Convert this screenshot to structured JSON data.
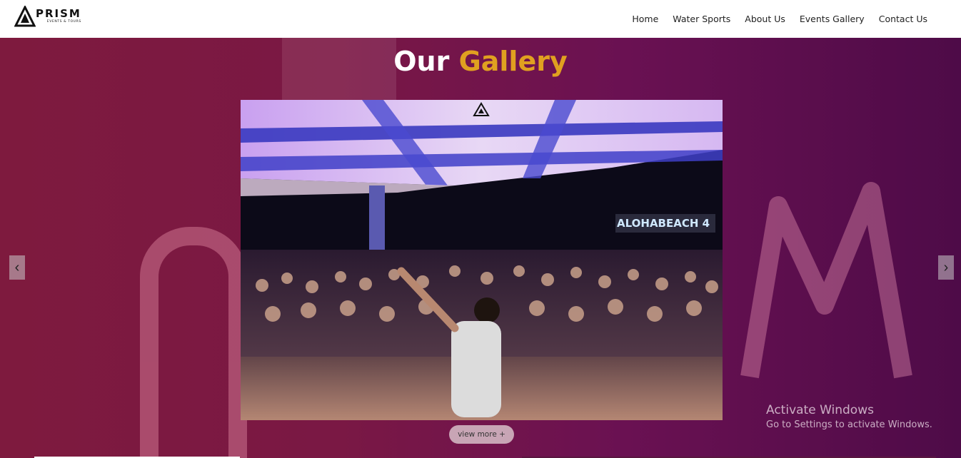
{
  "brand": {
    "name": "PRISM",
    "tagline": "EVENTS & TOURS"
  },
  "nav": {
    "items": [
      {
        "label": "Home"
      },
      {
        "label": "Water Sports"
      },
      {
        "label": "About Us"
      },
      {
        "label": "Events Gallery"
      },
      {
        "label": "Contact Us"
      }
    ]
  },
  "hero": {
    "title_main": "Our",
    "title_accent": "Gallery",
    "prev_label": "‹",
    "next_label": "›",
    "view_more": "view more +",
    "photo": {
      "banner_text": "ALOHABEACH 4",
      "logo_text": "PRISM"
    }
  },
  "watermark": {
    "title": "Activate Windows",
    "subtitle": "Go to Settings to activate Windows."
  },
  "colors": {
    "accent": "#e0a020",
    "header_bg": "#ffffff",
    "hero_bg": "#7a1844"
  }
}
